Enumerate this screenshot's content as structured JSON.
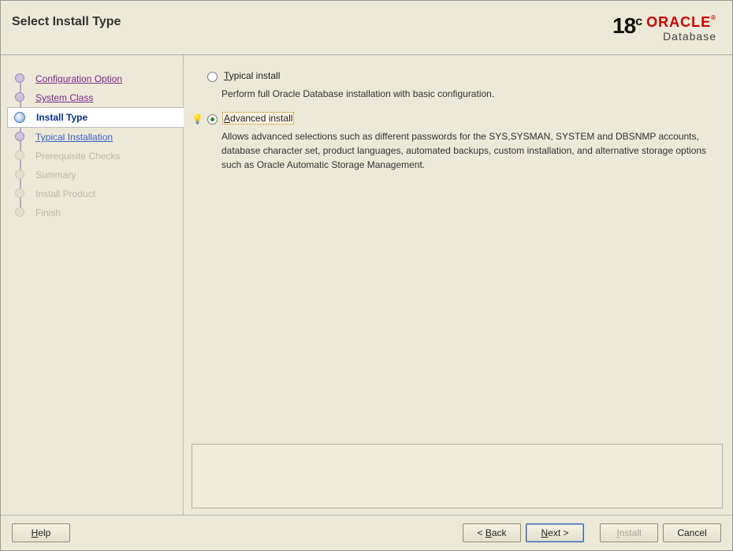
{
  "header": {
    "title": "Select Install Type",
    "logo": {
      "version_num": "18",
      "version_suffix": "c",
      "brand": "ORACLE",
      "sub": "Database"
    }
  },
  "steps": [
    {
      "label": "Configuration Option",
      "state": "done"
    },
    {
      "label": "System Class",
      "state": "done"
    },
    {
      "label": "Install Type",
      "state": "current"
    },
    {
      "label": "Typical Installation",
      "state": "future"
    },
    {
      "label": "Prerequisite Checks",
      "state": "disabled"
    },
    {
      "label": "Summary",
      "state": "disabled"
    },
    {
      "label": "Install Product",
      "state": "disabled"
    },
    {
      "label": "Finish",
      "state": "disabled"
    }
  ],
  "options": {
    "typical": {
      "label_pre": "",
      "mnemonic": "T",
      "label_post": "ypical install",
      "description": "Perform full Oracle Database installation with basic configuration.",
      "selected": false,
      "hint": false
    },
    "advanced": {
      "label_pre": "",
      "mnemonic": "A",
      "label_post": "dvanced install",
      "description": "Allows advanced selections such as different passwords for the SYS,SYSMAN, SYSTEM and DBSNMP accounts, database character set, product languages, automated backups, custom installation, and alternative storage options such as Oracle Automatic Storage Management.",
      "selected": true,
      "hint": true
    }
  },
  "footer": {
    "help_pre": "",
    "help_mn": "H",
    "help_post": "elp",
    "back_pre": "< ",
    "back_mn": "B",
    "back_post": "ack",
    "next_pre": "",
    "next_mn": "N",
    "next_post": "ext >",
    "install_pre": "",
    "install_mn": "I",
    "install_post": "nstall",
    "cancel": "Cancel",
    "install_enabled": false
  }
}
